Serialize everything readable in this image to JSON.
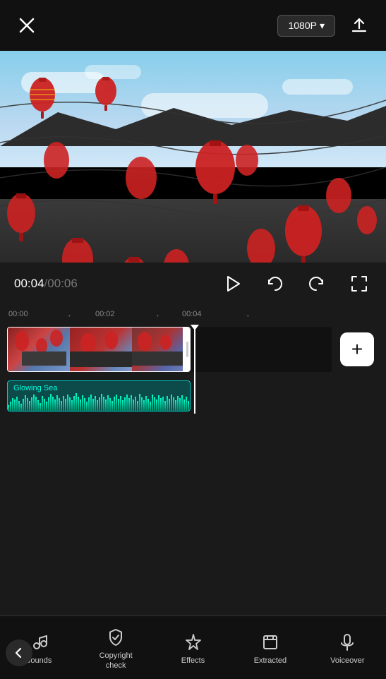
{
  "topBar": {
    "closeLabel": "×",
    "resolution": "1080P",
    "resolutionDropdown": "▾"
  },
  "playback": {
    "currentTime": "00:04",
    "separator": " / ",
    "totalTime": "00:06"
  },
  "timeline": {
    "marks": [
      "00:00",
      "00:02",
      "00:04"
    ],
    "trackName": "Glowing Sea"
  },
  "controls": {
    "playIcon": "▷",
    "undoIcon": "↺",
    "redoIcon": "↻",
    "fullscreenIcon": "⛶"
  },
  "bottomNav": {
    "backIcon": "‹",
    "items": [
      {
        "id": "sounds",
        "label": "Sounds"
      },
      {
        "id": "copyright",
        "label": "Copyright\ncheck"
      },
      {
        "id": "effects",
        "label": "Effects"
      },
      {
        "id": "extracted",
        "label": "Extracted"
      },
      {
        "id": "voiceover",
        "label": "Voiceover"
      }
    ]
  },
  "addButton": "+"
}
